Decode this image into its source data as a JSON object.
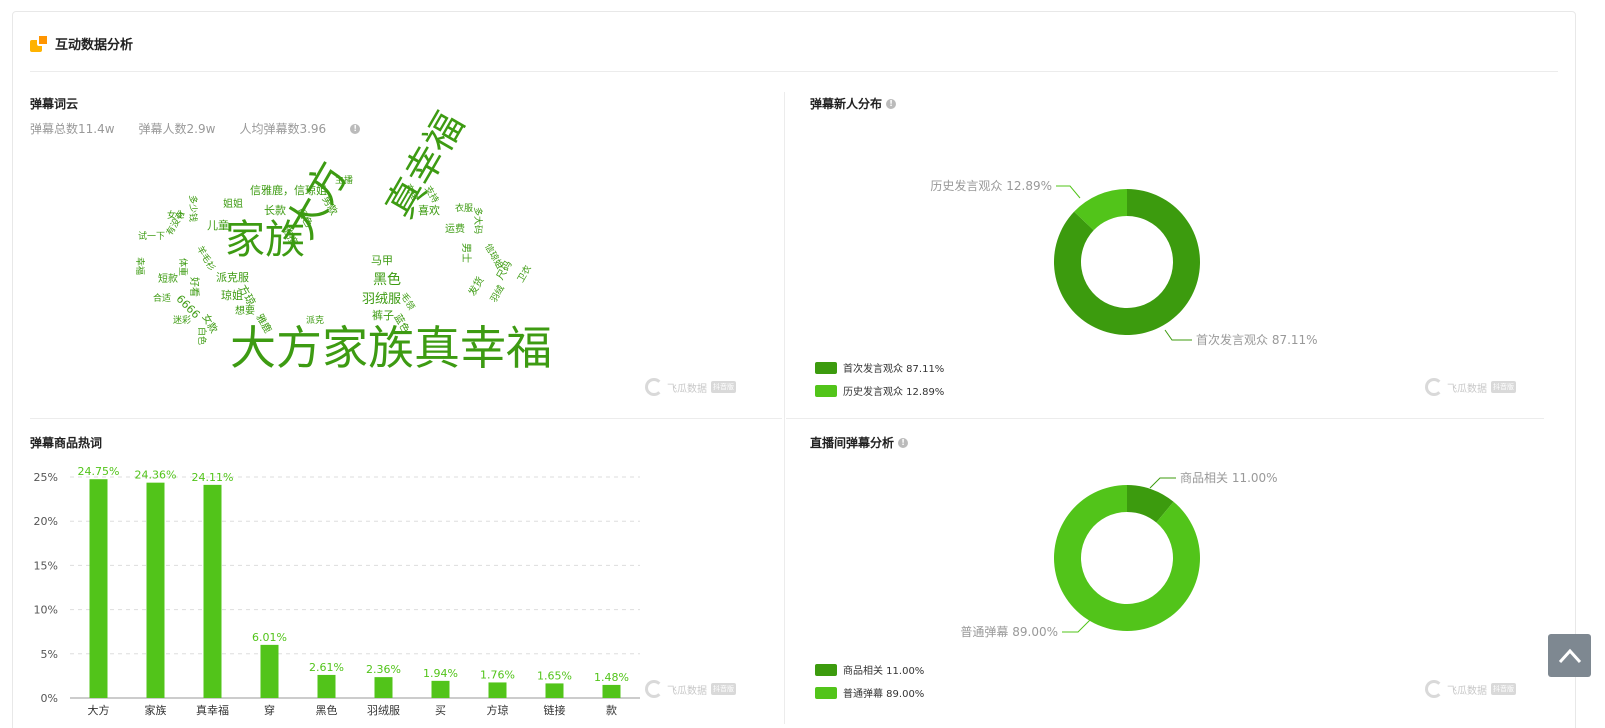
{
  "card": {
    "title": "互动数据分析",
    "icon": "data-analysis-icon"
  },
  "wordcloud_section": {
    "title": "弹幕词云",
    "stats": [
      "弹幕总数11.4w",
      "弹幕人数2.9w",
      "人均弹幕数3.96"
    ],
    "words": [
      {
        "text": "大方家族真幸福",
        "size": 46
      },
      {
        "text": "家族",
        "size": 40
      },
      {
        "text": "大方",
        "size": 40
      },
      {
        "text": "真幸福",
        "size": 38
      },
      {
        "text": "黑色",
        "size": 14
      },
      {
        "text": "羽绒服",
        "size": 13
      },
      {
        "text": "裤子",
        "size": 11
      },
      {
        "text": "马甲",
        "size": 11
      },
      {
        "text": "信雅鹿，信琼姐",
        "size": 11
      },
      {
        "text": "姐姐",
        "size": 10
      },
      {
        "text": "长款",
        "size": 11
      },
      {
        "text": "儿童",
        "size": 11
      },
      {
        "text": "喜欢",
        "size": 11
      },
      {
        "text": "运费",
        "size": 10
      },
      {
        "text": "男士",
        "size": 10
      },
      {
        "text": "派克服",
        "size": 11
      },
      {
        "text": "琼姐",
        "size": 11
      },
      {
        "text": "方琼",
        "size": 11
      },
      {
        "text": "短款",
        "size": 10
      },
      {
        "text": "6666",
        "size": 11
      },
      {
        "text": "想要",
        "size": 10
      },
      {
        "text": "女款",
        "size": 10
      },
      {
        "text": "雅鹿",
        "size": 10
      },
      {
        "text": "派克",
        "size": 9
      },
      {
        "text": "发货",
        "size": 10
      },
      {
        "text": "尺码",
        "size": 10
      },
      {
        "text": "卫衣",
        "size": 9
      },
      {
        "text": "羽绒",
        "size": 9
      },
      {
        "text": "衣服",
        "size": 9
      },
      {
        "text": "多大码",
        "size": 9
      },
      {
        "text": "信琼姐",
        "size": 9
      },
      {
        "text": "主播",
        "size": 9
      },
      {
        "text": "男款",
        "size": 10
      },
      {
        "text": "链接",
        "size": 10
      },
      {
        "text": "颜色",
        "size": 10
      },
      {
        "text": "充电",
        "size": 9
      },
      {
        "text": "支持",
        "size": 9
      },
      {
        "text": "女士",
        "size": 9
      },
      {
        "text": "多少钱",
        "size": 9
      },
      {
        "text": "试一下",
        "size": 9
      },
      {
        "text": "有没有",
        "size": 9
      },
      {
        "text": "羊毛衫",
        "size": 9
      },
      {
        "text": "幸福",
        "size": 9
      },
      {
        "text": "体重",
        "size": 9
      },
      {
        "text": "合适",
        "size": 9
      },
      {
        "text": "好看",
        "size": 10
      },
      {
        "text": "迷彩",
        "size": 9
      },
      {
        "text": "白色",
        "size": 9
      },
      {
        "text": "蓝色",
        "size": 10
      },
      {
        "text": "毛领",
        "size": 9
      }
    ]
  },
  "newcomer_section": {
    "title": "弹幕新人分布",
    "chart_data": {
      "type": "pie",
      "labels": [
        "首次发言观众",
        "历史发言观众"
      ],
      "values": [
        87.11,
        12.89
      ],
      "colors": [
        "#3c9b0e",
        "#52c41a"
      ],
      "callouts": [
        "首次发言观众 87.11%",
        "历史发言观众 12.89%"
      ],
      "legend": [
        "首次发言观众 87.11%",
        "历史发言观众 12.89%"
      ]
    }
  },
  "hotword_section": {
    "title": "弹幕商品热词",
    "chart_data": {
      "type": "bar",
      "categories": [
        "大方",
        "家族",
        "真幸福",
        "穿",
        "黑色",
        "羽绒服",
        "买",
        "方琼",
        "链接",
        "款"
      ],
      "values": [
        24.75,
        24.36,
        24.11,
        6.01,
        2.61,
        2.36,
        1.94,
        1.76,
        1.65,
        1.48
      ],
      "labels": [
        "24.75%",
        "24.36%",
        "24.11%",
        "6.01%",
        "2.61%",
        "2.36%",
        "1.94%",
        "1.76%",
        "1.65%",
        "1.48%"
      ],
      "ylim": [
        0,
        25
      ],
      "yticks": [
        "0%",
        "5%",
        "10%",
        "15%",
        "20%",
        "25%"
      ],
      "ytick_values": [
        0,
        5,
        10,
        15,
        20,
        25
      ],
      "grid": true,
      "color": "#52c41a"
    }
  },
  "live_section": {
    "title": "直播间弹幕分析",
    "chart_data": {
      "type": "pie",
      "labels": [
        "商品相关",
        "普通弹幕"
      ],
      "values": [
        11.0,
        89.0
      ],
      "colors": [
        "#3c9b0e",
        "#52c41a"
      ],
      "callouts": [
        "商品相关 11.00%",
        "普通弹幕 89.00%"
      ],
      "legend": [
        "商品相关 11.00%",
        "普通弹幕 89.00%"
      ]
    }
  },
  "watermark": {
    "text": "飞瓜数据",
    "badge": "抖音版",
    "sub": "FEIGUA.CN"
  }
}
